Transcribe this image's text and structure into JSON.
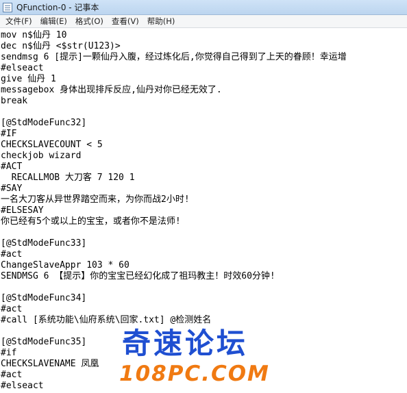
{
  "window": {
    "title": "QFunction-0 - 记事本",
    "icon": "notepad-icon"
  },
  "menu": {
    "items": [
      "文件(F)",
      "编辑(E)",
      "格式(O)",
      "查看(V)",
      "帮助(H)"
    ]
  },
  "editor": {
    "lines": [
      "mov n$仙丹 10",
      "dec n$仙丹 <$str(U123)>",
      "sendmsg 6 [提示]一颗仙丹入腹，经过炼化后,你觉得自己得到了上天的眷顾！幸运增",
      "#elseact",
      "give 仙丹 1",
      "messagebox 身体出现排斥反应,仙丹对你已经无效了.",
      "break",
      "",
      "[@StdModeFunc32]",
      "#IF",
      "CHECKSLAVECOUNT < 5",
      "checkjob wizard",
      "#ACT",
      "  RECALLMOB 大刀客 7 120 1",
      "#SAY",
      "一名大刀客从异世界踏空而来，为你而战2小时!",
      "#ELSESAY",
      "你已经有5个或以上的宝宝，或者你不是法师!",
      "",
      "[@StdModeFunc33]",
      "#act",
      "ChangeSlaveAppr 103 * 60",
      "SENDMSG 6 【提示】你的宝宝已经幻化成了祖玛教主！时效60分钟!",
      "",
      "[@StdModeFunc34]",
      "#act",
      "#call [系统功能\\仙府系统\\回家.txt] @检测姓名",
      "",
      "[@StdModeFunc35]",
      "#if",
      "CHECKSLAVENAME 凤凰",
      "#act",
      "#elseact"
    ]
  },
  "watermark": {
    "line1": "奇速论坛",
    "line2": "108PC.COM"
  }
}
